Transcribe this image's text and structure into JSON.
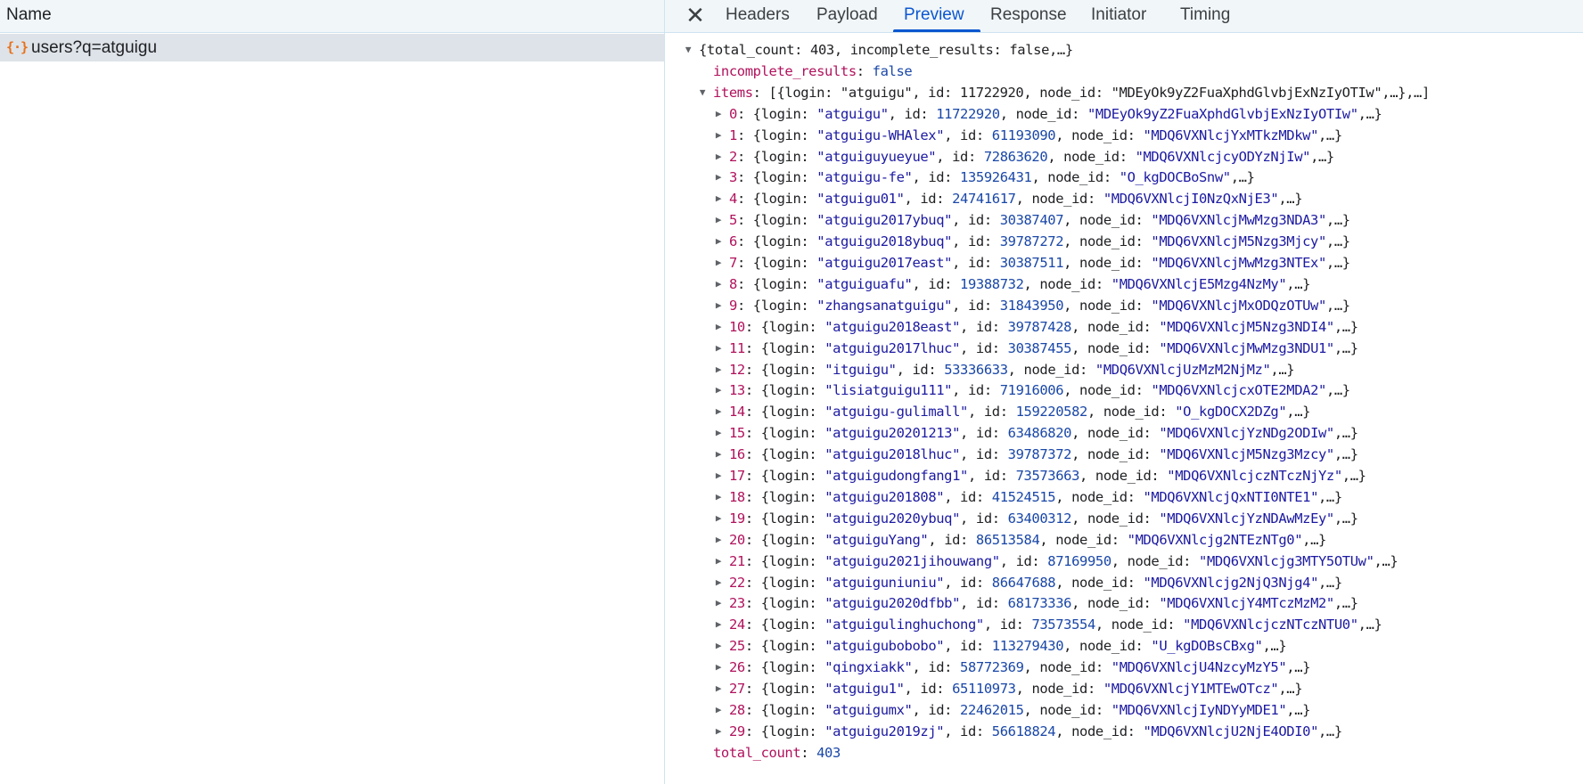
{
  "left_panel": {
    "header": "Name",
    "request": {
      "icon": "{·}",
      "label": "users?q=atguigu"
    }
  },
  "tabs": [
    "Headers",
    "Payload",
    "Preview",
    "Response",
    "Initiator",
    "Timing"
  ],
  "active_tab": "Preview",
  "preview": {
    "root_summary": "{total_count: 403, incomplete_results: false,…}",
    "incomplete_results_key": "incomplete_results",
    "incomplete_results_value": "false",
    "items_key": "items",
    "items_summary": "[{login: \"atguigu\", id: 11722920, node_id: \"MDEyOk9yZ2FuaXphdGlvbjExNzIyOTIw\",…},…]",
    "items": [
      {
        "login": "atguigu",
        "id": "11722920",
        "node_id": "MDEyOk9yZ2FuaXphdGlvbjExNzIyOTIw"
      },
      {
        "login": "atguigu-WHAlex",
        "id": "61193090",
        "node_id": "MDQ6VXNlcjYxMTkzMDkw"
      },
      {
        "login": "atguiguyueyue",
        "id": "72863620",
        "node_id": "MDQ6VXNlcjcyODYzNjIw"
      },
      {
        "login": "atguigu-fe",
        "id": "135926431",
        "node_id": "O_kgDOCBoSnw"
      },
      {
        "login": "atguigu01",
        "id": "24741617",
        "node_id": "MDQ6VXNlcjI0NzQxNjE3"
      },
      {
        "login": "atguigu2017ybuq",
        "id": "30387407",
        "node_id": "MDQ6VXNlcjMwMzg3NDA3"
      },
      {
        "login": "atguigu2018ybuq",
        "id": "39787272",
        "node_id": "MDQ6VXNlcjM5Nzg3Mjcy"
      },
      {
        "login": "atguigu2017east",
        "id": "30387511",
        "node_id": "MDQ6VXNlcjMwMzg3NTEx"
      },
      {
        "login": "atguiguafu",
        "id": "19388732",
        "node_id": "MDQ6VXNlcjE5Mzg4NzMy"
      },
      {
        "login": "zhangsanatguigu",
        "id": "31843950",
        "node_id": "MDQ6VXNlcjMxODQzOTUw"
      },
      {
        "login": "atguigu2018east",
        "id": "39787428",
        "node_id": "MDQ6VXNlcjM5Nzg3NDI4"
      },
      {
        "login": "atguigu2017lhuc",
        "id": "30387455",
        "node_id": "MDQ6VXNlcjMwMzg3NDU1"
      },
      {
        "login": "itguigu",
        "id": "53336633",
        "node_id": "MDQ6VXNlcjUzMzM2NjMz"
      },
      {
        "login": "lisiatguigu111",
        "id": "71916006",
        "node_id": "MDQ6VXNlcjcxOTE2MDA2"
      },
      {
        "login": "atguigu-gulimall",
        "id": "159220582",
        "node_id": "O_kgDOCX2DZg"
      },
      {
        "login": "atguigu20201213",
        "id": "63486820",
        "node_id": "MDQ6VXNlcjYzNDg2ODIw"
      },
      {
        "login": "atguigu2018lhuc",
        "id": "39787372",
        "node_id": "MDQ6VXNlcjM5Nzg3Mzcy"
      },
      {
        "login": "atguigudongfang1",
        "id": "73573663",
        "node_id": "MDQ6VXNlcjczNTczNjYz"
      },
      {
        "login": "atguigu201808",
        "id": "41524515",
        "node_id": "MDQ6VXNlcjQxNTI0NTE1"
      },
      {
        "login": "atguigu2020ybuq",
        "id": "63400312",
        "node_id": "MDQ6VXNlcjYzNDAwMzEy"
      },
      {
        "login": "atguiguYang",
        "id": "86513584",
        "node_id": "MDQ6VXNlcjg2NTEzNTg0"
      },
      {
        "login": "atguigu2021jihouwang",
        "id": "87169950",
        "node_id": "MDQ6VXNlcjg3MTY5OTUw"
      },
      {
        "login": "atguiguniuniu",
        "id": "86647688",
        "node_id": "MDQ6VXNlcjg2NjQ3Njg4"
      },
      {
        "login": "atguigu2020dfbb",
        "id": "68173336",
        "node_id": "MDQ6VXNlcjY4MTczMzM2"
      },
      {
        "login": "atguigulinghuchong",
        "id": "73573554",
        "node_id": "MDQ6VXNlcjczNTczNTU0"
      },
      {
        "login": "atguigubobobo",
        "id": "113279430",
        "node_id": "U_kgDOBsCBxg"
      },
      {
        "login": "qingxiakk",
        "id": "58772369",
        "node_id": "MDQ6VXNlcjU4NzcyMzY5"
      },
      {
        "login": "atguigu1",
        "id": "65110973",
        "node_id": "MDQ6VXNlcjY1MTEwOTcz"
      },
      {
        "login": "atguigumx",
        "id": "22462015",
        "node_id": "MDQ6VXNlcjIyNDYyMDE1"
      },
      {
        "login": "atguigu2019zj",
        "id": "56618824",
        "node_id": "MDQ6VXNlcjU2NjE4ODI0"
      }
    ],
    "total_count_key": "total_count",
    "total_count_value": "403"
  },
  "colors": {
    "key": "#b0125c",
    "number": "#1a47a8",
    "string": "#1c1aa1",
    "active_tab": "#0b57d0",
    "request_icon": "#e8711c"
  }
}
